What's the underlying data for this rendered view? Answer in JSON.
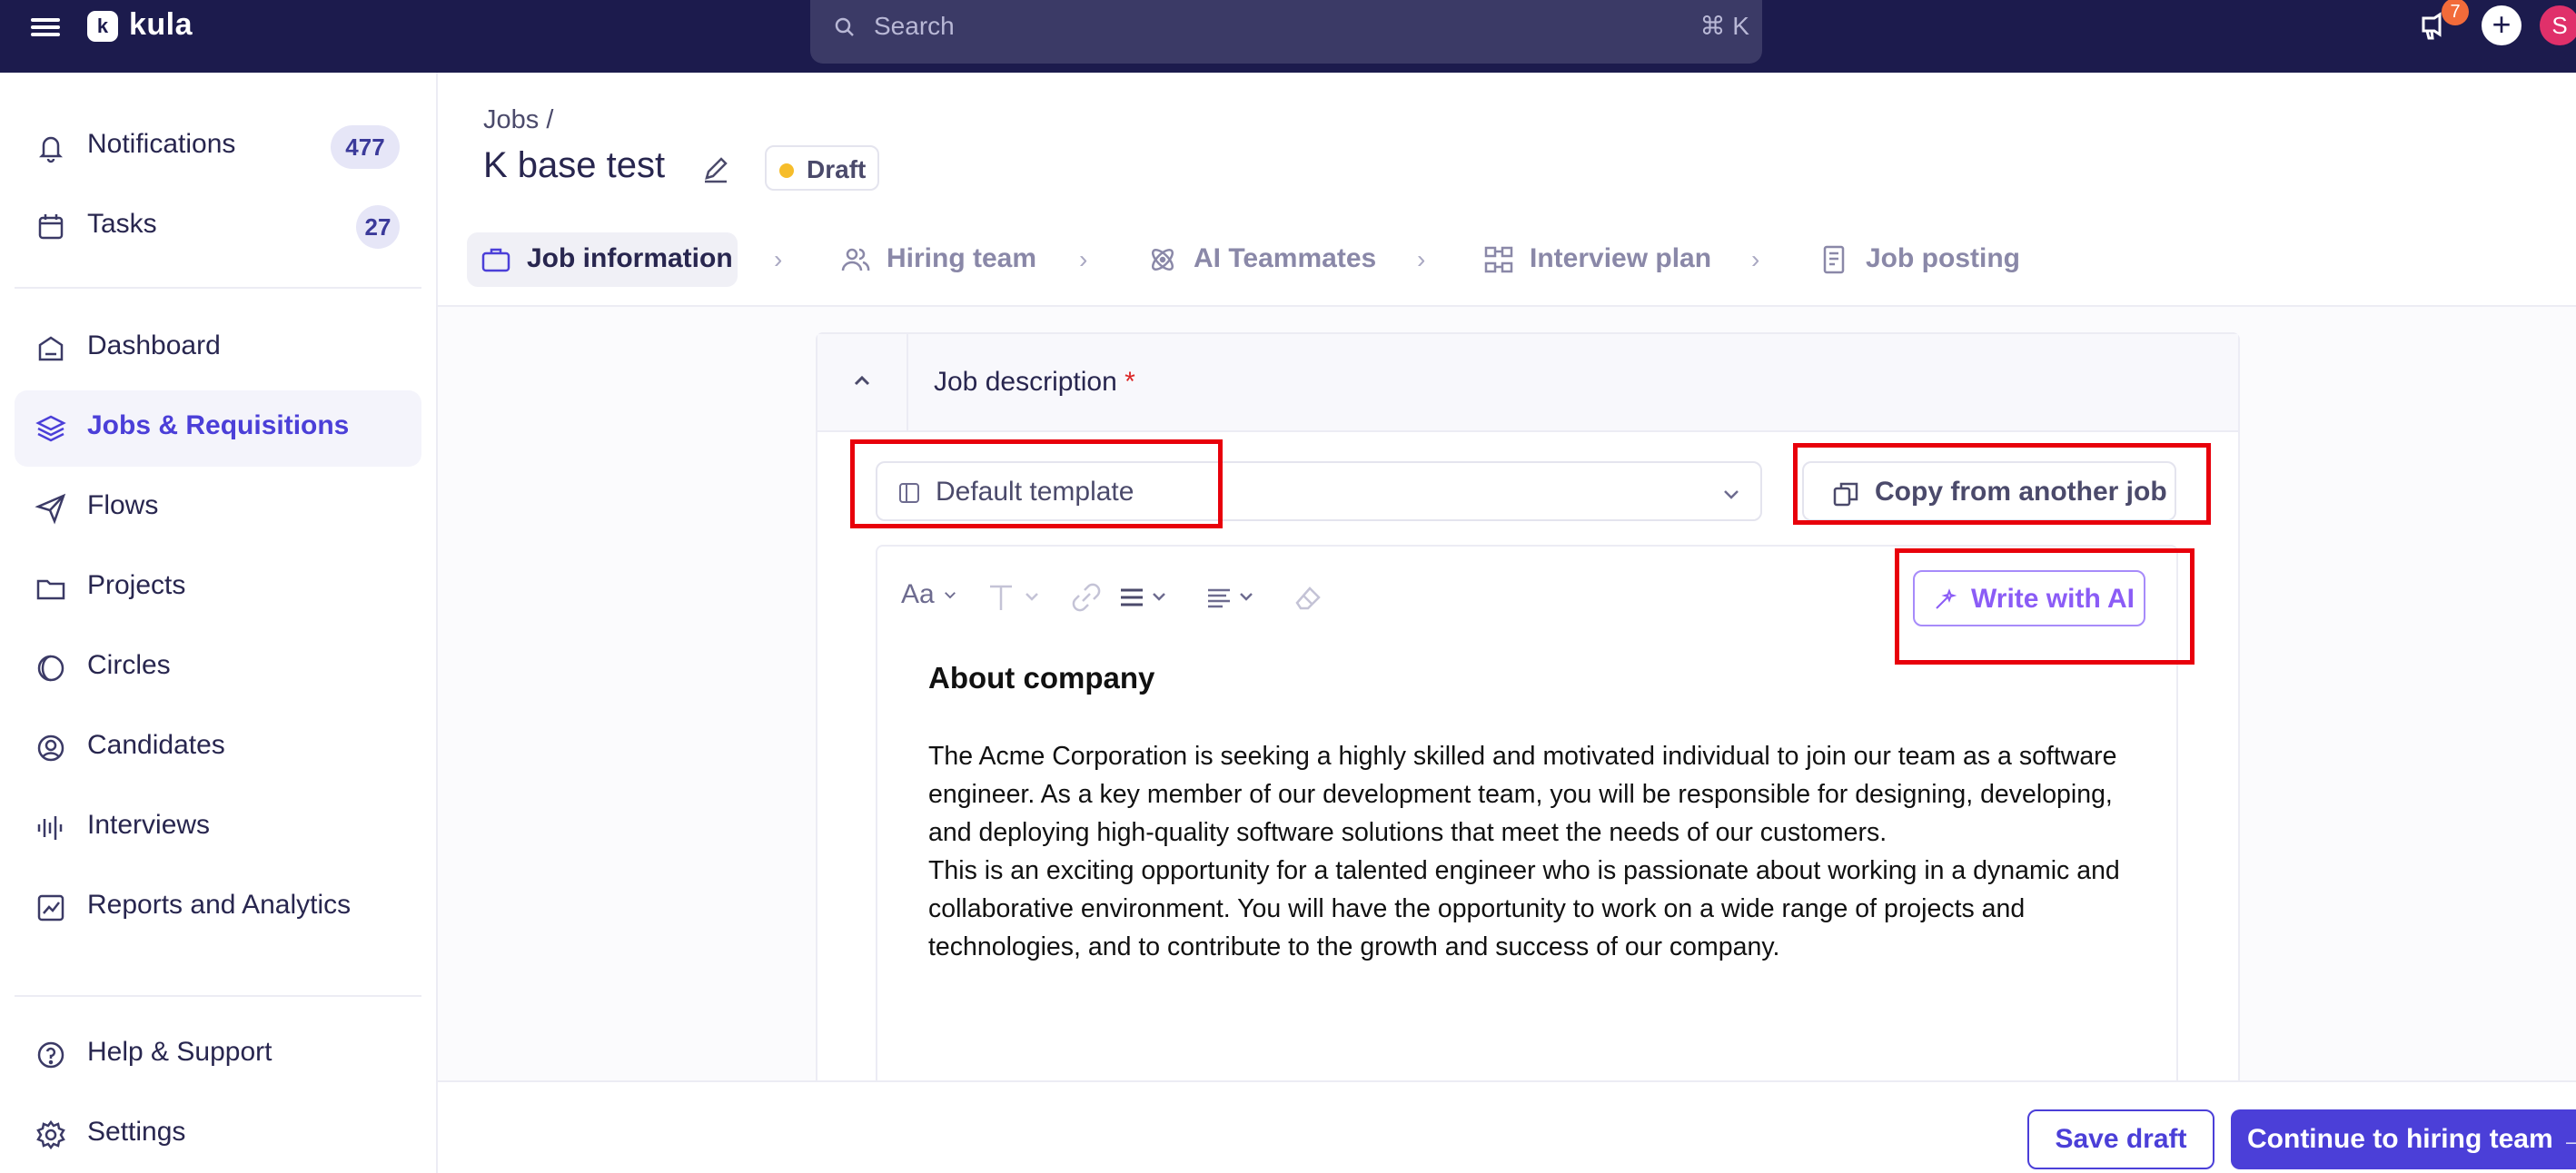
{
  "app": {
    "name": "kula"
  },
  "topbar": {
    "search_placeholder": "Search",
    "search_shortcut": "⌘ K",
    "notification_badge": "7",
    "avatar_initial": "S"
  },
  "sidebar": {
    "items": [
      {
        "label": "Notifications",
        "count": "477",
        "icon": "bell-icon"
      },
      {
        "label": "Tasks",
        "count": "27",
        "icon": "calendar-icon"
      },
      {
        "label": "Dashboard",
        "icon": "home-icon"
      },
      {
        "label": "Jobs & Requisitions",
        "icon": "layers-icon",
        "active": true
      },
      {
        "label": "Flows",
        "icon": "send-icon"
      },
      {
        "label": "Projects",
        "icon": "folder-icon"
      },
      {
        "label": "Circles",
        "icon": "circles-icon"
      },
      {
        "label": "Candidates",
        "icon": "user-circle-icon"
      },
      {
        "label": "Interviews",
        "icon": "audio-wave-icon"
      },
      {
        "label": "Reports and Analytics",
        "icon": "chart-icon"
      }
    ],
    "bottom": [
      {
        "label": "Help & Support",
        "icon": "help-icon"
      },
      {
        "label": "Settings",
        "icon": "gear-icon"
      }
    ]
  },
  "header": {
    "breadcrumb": "Jobs /",
    "title": "K base test",
    "status": "Draft"
  },
  "steps": [
    {
      "label": "Job information",
      "icon": "briefcase-icon",
      "active": true
    },
    {
      "label": "Hiring team",
      "icon": "users-icon"
    },
    {
      "label": "AI Teammates",
      "icon": "atom-icon"
    },
    {
      "label": "Interview plan",
      "icon": "flow-icon"
    },
    {
      "label": "Job posting",
      "icon": "document-icon"
    }
  ],
  "section": {
    "title": "Job description",
    "required_mark": "*",
    "template_select": "Default template",
    "copy_button": "Copy from another job",
    "ai_button": "Write with AI",
    "toolbar_text_style": "Aa"
  },
  "document": {
    "heading": "About company",
    "paragraph1": "The Acme Corporation is seeking a highly skilled and motivated individual to join our team as a software engineer. As a key member of our development team, you will be responsible for designing, developing, and deploying high-quality software solutions that meet the needs of our customers.",
    "paragraph2": "This is an exciting opportunity for a talented engineer who is passionate about working in a dynamic and collaborative environment. You will have the opportunity to work on a wide range of projects and technologies, and to contribute to the growth and success of our company."
  },
  "footer": {
    "save_draft": "Save draft",
    "continue": "Continue to hiring team"
  },
  "colors": {
    "topbar": "#1c1b4d",
    "accent": "#4b3fd8",
    "ai_accent": "#8b5cf6",
    "highlight": "#e8000b",
    "draft_dot": "#f6bd2b"
  }
}
